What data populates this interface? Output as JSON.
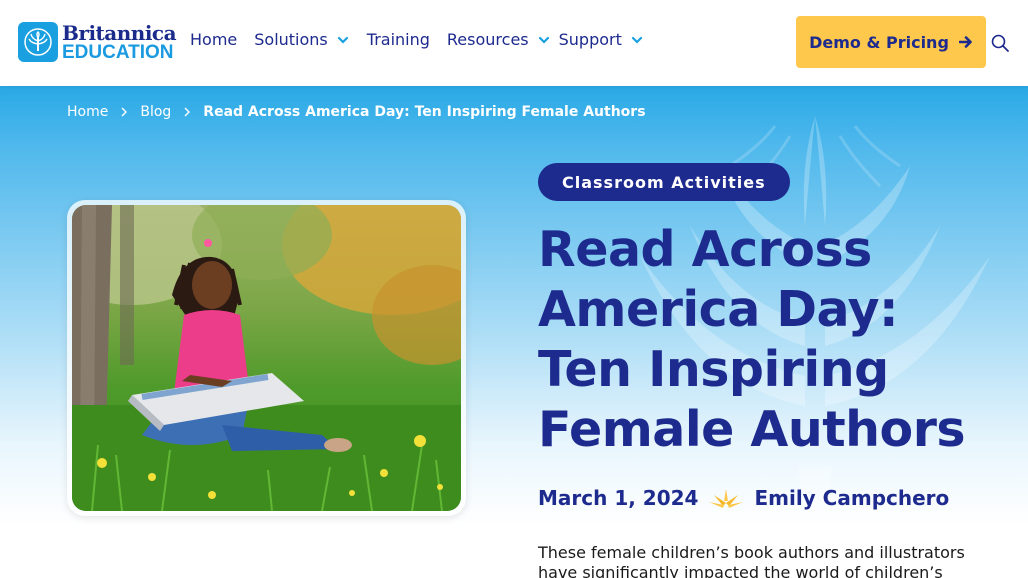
{
  "brand": {
    "name_line1": "Britannica",
    "name_line2": "EDUCATION"
  },
  "nav": {
    "home": "Home",
    "solutions": "Solutions",
    "training": "Training",
    "resources": "Resources",
    "support": "Support"
  },
  "cta": {
    "demo_label": "Demo & Pricing"
  },
  "breadcrumb": {
    "home": "Home",
    "blog": "Blog",
    "current": "Read Across America Day: Ten Inspiring Female Authors"
  },
  "article": {
    "category": "Classroom Activities",
    "title": "Read Across America Day: Ten Inspiring Female Authors",
    "date": "March 1, 2024",
    "author": "Emily Campchero",
    "excerpt": "These female children’s book authors and illustrators have significantly impacted the world of children’s"
  },
  "colors": {
    "brand_navy": "#1d2a8e",
    "brand_blue": "#1aa0e0",
    "accent_yellow": "#fdc84c"
  },
  "icons": [
    "tree-logo-icon",
    "chevron-down-icon",
    "arrow-right-icon",
    "search-icon",
    "chevron-right-icon",
    "sparkle-icon"
  ]
}
